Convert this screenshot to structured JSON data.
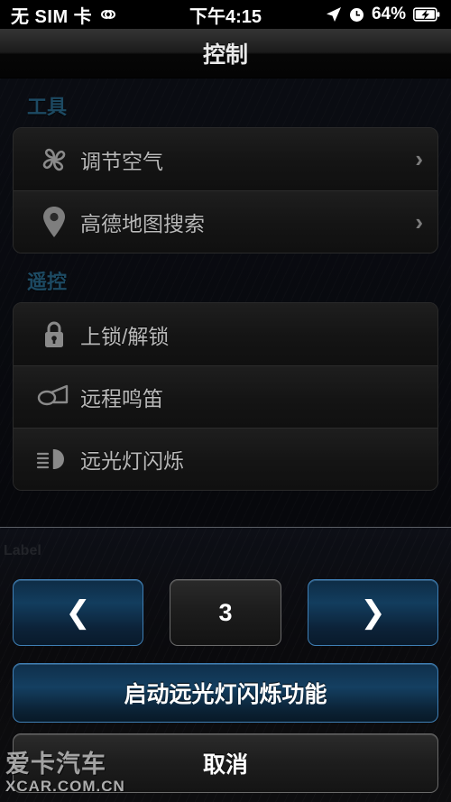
{
  "statusbar": {
    "carrier": "无 SIM 卡",
    "link_icon": "link-icon",
    "time": "下午4:15",
    "location_icon": "location-arrow-icon",
    "alarm_icon": "alarm-clock-icon",
    "battery_percent": "64%",
    "battery_icon": "battery-charging-icon"
  },
  "navbar": {
    "title": "控制"
  },
  "sections": [
    {
      "header": "工具",
      "rows": [
        {
          "icon": "fan-icon",
          "label": "调节空气",
          "chevron": "›"
        },
        {
          "icon": "map-pin-icon",
          "label": "高德地图搜索",
          "chevron": "›"
        }
      ]
    },
    {
      "header": "遥控",
      "rows": [
        {
          "icon": "lock-icon",
          "label": "上锁/解锁"
        },
        {
          "icon": "horn-icon",
          "label": "远程鸣笛"
        },
        {
          "icon": "highbeam-icon",
          "label": "远光灯闪烁"
        }
      ]
    }
  ],
  "sheet": {
    "label": "Label",
    "stepper": {
      "prev_icon": "chevron-left-icon",
      "prev_glyph": "❮",
      "value": "3",
      "next_icon": "chevron-right-icon",
      "next_glyph": "❯"
    },
    "action_label": "启动远光灯闪烁功能",
    "cancel_label": "取消"
  },
  "watermark": {
    "cn": "爱卡汽车",
    "en": "XCAR.COM.CN"
  },
  "colors": {
    "accent_blue": "#3f7fb5",
    "section_header": "#1d4a63",
    "row_label": "#b9b9b9",
    "background": "#07080c"
  }
}
